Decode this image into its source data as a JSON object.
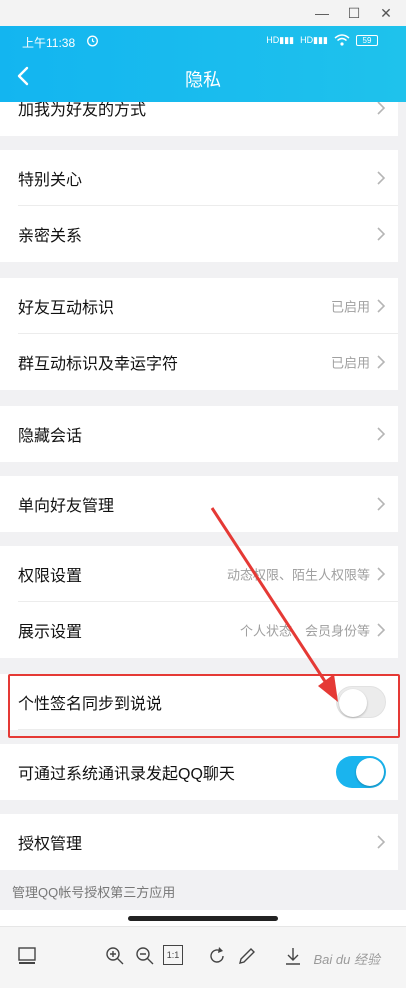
{
  "status_bar": {
    "time": "上午11:38",
    "signal1": "HD",
    "signal2": "HD",
    "battery": "59"
  },
  "header": {
    "title": "隐私",
    "accent": "#1ab4ee"
  },
  "rows": {
    "add_friend": {
      "label": "加我为好友的方式"
    },
    "special_care": {
      "label": "特别关心"
    },
    "intimate": {
      "label": "亲密关系"
    },
    "friend_interaction": {
      "label": "好友互动标识",
      "value": "已启用"
    },
    "group_interaction": {
      "label": "群互动标识及幸运字符",
      "value": "已启用"
    },
    "hide_chat": {
      "label": "隐藏会话"
    },
    "one_way": {
      "label": "单向好友管理"
    },
    "permissions": {
      "label": "权限设置",
      "value": "动态权限、陌生人权限等"
    },
    "display": {
      "label": "展示设置",
      "value": "个人状态、会员身份等"
    },
    "signature_sync": {
      "label": "个性签名同步到说说",
      "toggle": false
    },
    "contacts_chat": {
      "label": "可通过系统通讯录发起QQ聊天",
      "toggle": true
    },
    "authorization": {
      "label": "授权管理"
    }
  },
  "footer_note": "管理QQ帐号授权第三方应用",
  "toolbar": {
    "zoom_label": "1:1",
    "watermark": "Bai du 经验"
  },
  "annotation_color": "#e53935"
}
